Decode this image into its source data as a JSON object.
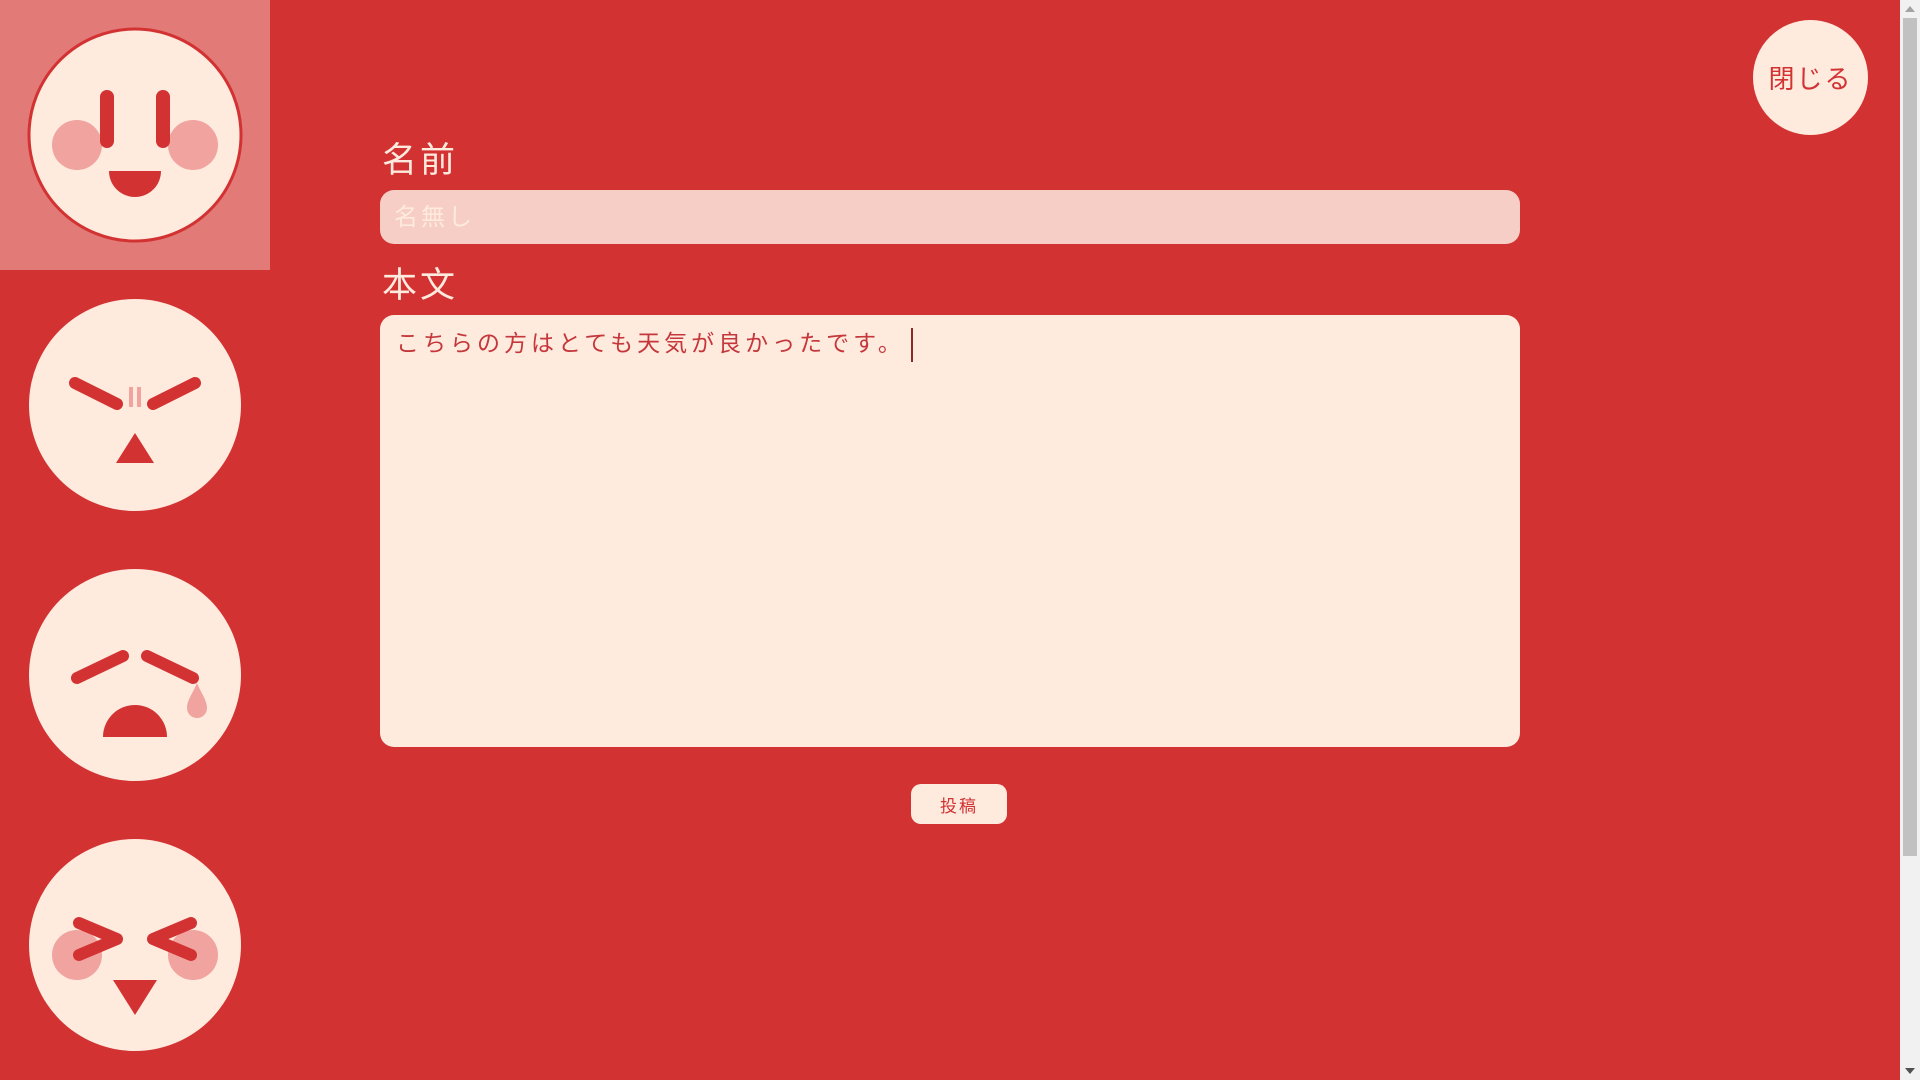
{
  "colors": {
    "background": "#d33233",
    "cream": "#ffeade",
    "blush": "#f0a39f",
    "selected_cell": "#e27a78"
  },
  "faces": [
    {
      "name": "smile-face-icon",
      "selected": true
    },
    {
      "name": "angry-face-icon",
      "selected": false
    },
    {
      "name": "sad-face-icon",
      "selected": false
    },
    {
      "name": "excited-face-icon",
      "selected": false
    }
  ],
  "close_button": {
    "label": "閉じる"
  },
  "form": {
    "name_label": "名前",
    "name_placeholder": "名無し",
    "name_value": "",
    "body_label": "本文",
    "body_value": "こちらの方はとても天気が良かったです。",
    "submit_label": "投稿"
  }
}
